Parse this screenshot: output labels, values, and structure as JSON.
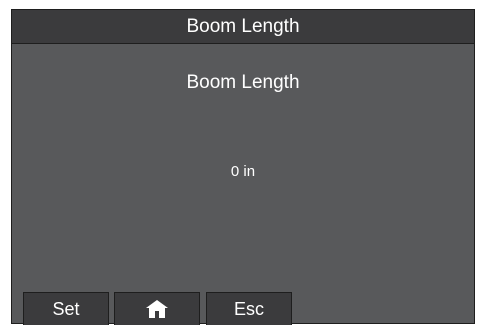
{
  "title_bar": {
    "title": "Boom Length"
  },
  "screen": {
    "heading": "Boom Length",
    "value": "0 in"
  },
  "softkeys": {
    "set_label": "Set",
    "home_icon": "home-icon",
    "esc_label": "Esc"
  },
  "colors": {
    "background": "#58595b",
    "bar": "#3b3b3d",
    "border": "#1e1e1e",
    "text": "#ffffff"
  }
}
